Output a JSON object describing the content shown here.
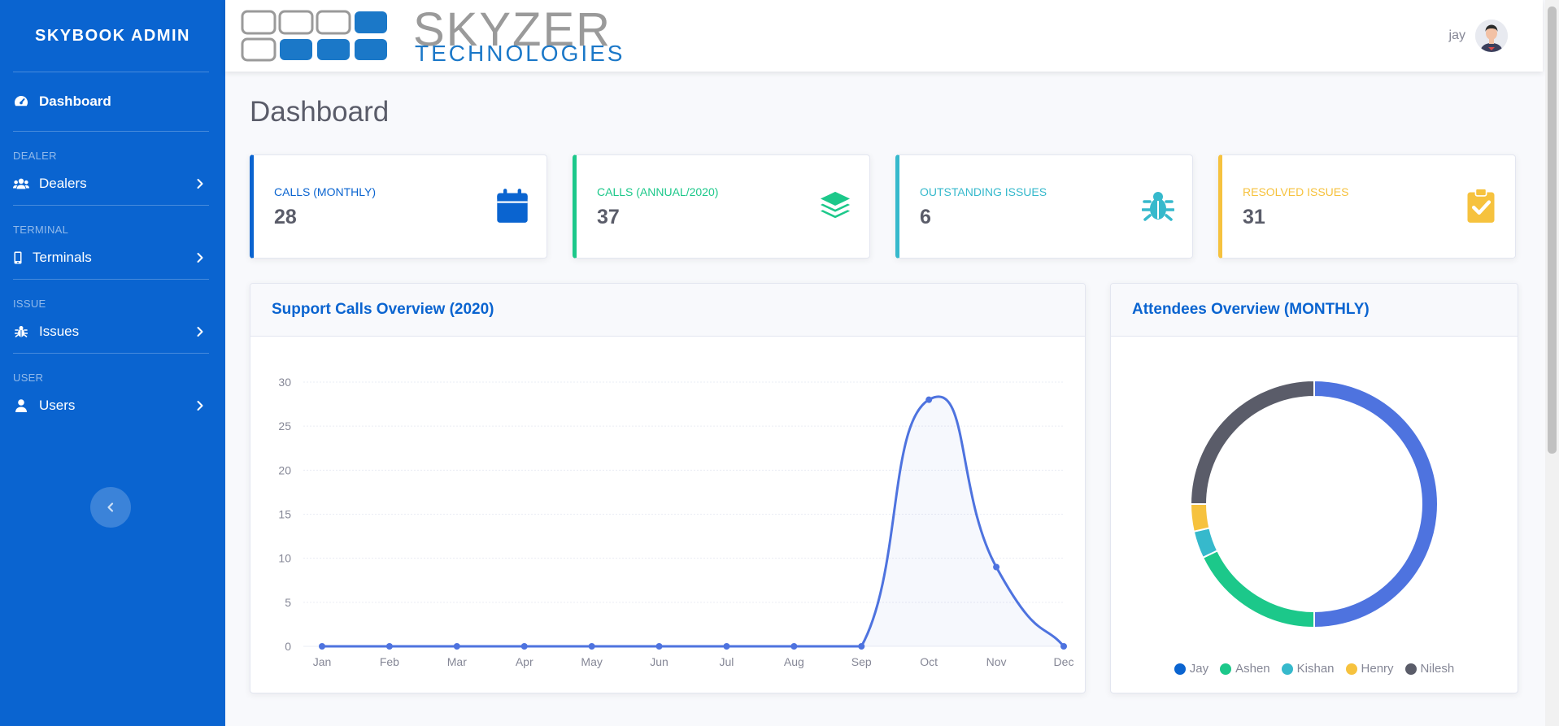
{
  "sidebar": {
    "brand": "SKYBOOK ADMIN",
    "dashboard_label": "Dashboard",
    "sections": [
      {
        "heading": "DEALER",
        "label": "Dealers"
      },
      {
        "heading": "TERMINAL",
        "label": "Terminals"
      },
      {
        "heading": "ISSUE",
        "label": "Issues"
      },
      {
        "heading": "USER",
        "label": "Users"
      }
    ]
  },
  "topbar": {
    "logo_line1": "SKYZER",
    "logo_line2": "TECHNOLOGIES",
    "user_name": "jay"
  },
  "page": {
    "title": "Dashboard"
  },
  "stats": [
    {
      "label": "CALLS (MONTHLY)",
      "value": "28",
      "color": "#0a64d0",
      "icon": "calendar-icon"
    },
    {
      "label": "CALLS (ANNUAL/2020)",
      "value": "37",
      "color": "#1cc88a",
      "icon": "layers-icon"
    },
    {
      "label": "OUTSTANDING ISSUES",
      "value": "6",
      "color": "#36b9cc",
      "icon": "bug-icon"
    },
    {
      "label": "RESOLVED ISSUES",
      "value": "31",
      "color": "#f6c23e",
      "icon": "clipboard-check-icon"
    }
  ],
  "panels": {
    "line_title": "Support Calls Overview (2020)",
    "donut_title": "Attendees Overview (MONTHLY)"
  },
  "chart_data": [
    {
      "type": "area",
      "title": "Support Calls Overview (2020)",
      "categories": [
        "Jan",
        "Feb",
        "Mar",
        "Apr",
        "May",
        "Jun",
        "Jul",
        "Aug",
        "Sep",
        "Oct",
        "Nov",
        "Dec"
      ],
      "values": [
        0,
        0,
        0,
        0,
        0,
        0,
        0,
        0,
        0,
        28,
        9,
        0
      ],
      "ylim": [
        0,
        30
      ],
      "yticks": [
        0,
        5,
        10,
        15,
        20,
        25,
        30
      ],
      "grid": true,
      "color": "#4e73df"
    },
    {
      "type": "pie",
      "title": "Attendees Overview (MONTHLY)",
      "categories": [
        "Jay",
        "Ashen",
        "Kishan",
        "Henry",
        "Nilesh"
      ],
      "values": [
        14,
        5,
        1,
        1,
        7
      ],
      "colors": [
        "#4e73df",
        "#1cc88a",
        "#36b9cc",
        "#f6c23e",
        "#5a5c69"
      ],
      "legend_colors": [
        "#0a64d0",
        "#1cc88a",
        "#36b9cc",
        "#f6c23e",
        "#5a5c69"
      ],
      "legend": "bottom"
    }
  ]
}
